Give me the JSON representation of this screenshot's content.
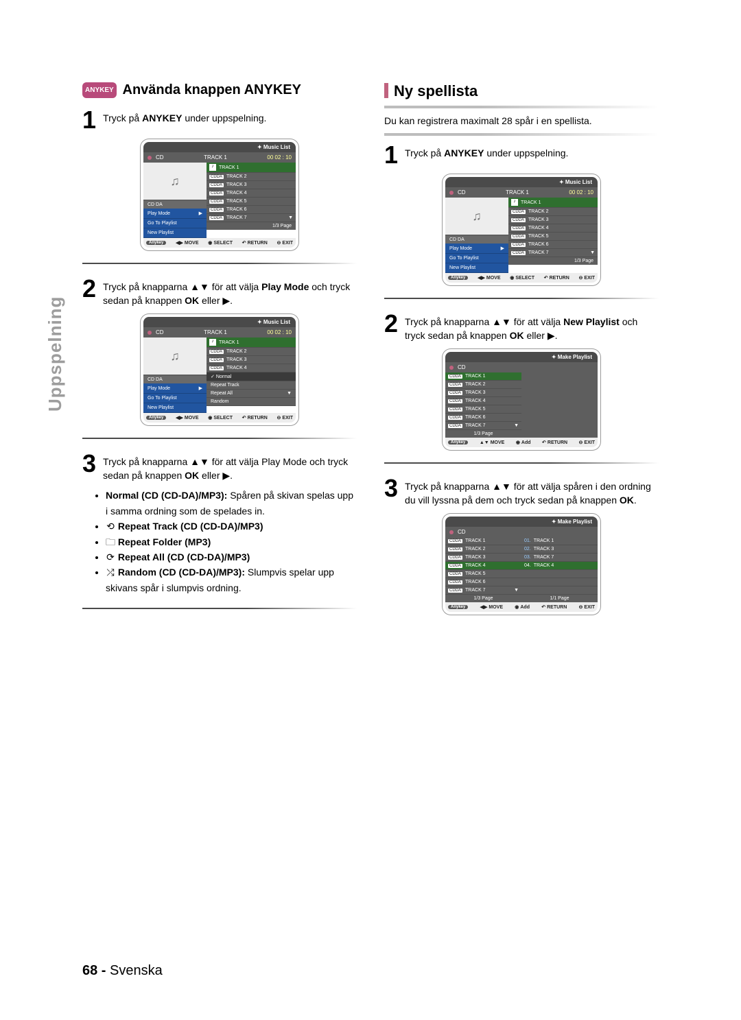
{
  "side_label": "Uppspelning",
  "footer": {
    "page": "68 -",
    "lang": "Svenska"
  },
  "left": {
    "badge": "ANYKEY",
    "heading": "Använda knappen ANYKEY",
    "step1": {
      "num": "1",
      "t1": "Tryck på ",
      "b1": "ANYKEY",
      "t2": " under uppspelning."
    },
    "step2": {
      "num": "2",
      "t1": "Tryck på knapparna ▲▼ för att välja ",
      "b1": "Play Mode",
      "t2": " och tryck sedan på knappen ",
      "b2": "OK",
      "t3": " eller ▶."
    },
    "step3": {
      "num": "3",
      "t1": "Tryck på knapparna ▲▼ för att välja Play Mode och tryck sedan på knappen ",
      "b1": "OK",
      "t2": " eller ▶."
    },
    "modes": {
      "m1a": "Normal (CD (CD-DA)/MP3):",
      "m1b": " Spåren på skivan spelas upp i samma ordning som de spelades in.",
      "m2": "Repeat Track (CD (CD-DA)/MP3)",
      "m3": "Repeat Folder (MP3)",
      "m4": "Repeat All (CD (CD-DA)/MP3)",
      "m5a": "Random (CD (CD-DA)/MP3):",
      "m5b": " Slumpvis spelar upp skivans spår i slumpvis ordning."
    }
  },
  "right": {
    "heading": "Ny spellista",
    "intro": "Du kan registrera maximalt 28 spår i en spellista.",
    "step1": {
      "num": "1",
      "t1": "Tryck på ",
      "b1": "ANYKEY",
      "t2": " under uppspelning."
    },
    "step2": {
      "num": "2",
      "t1": "Tryck på knapparna ▲▼ för att välja ",
      "b1": "New Playlist",
      "t2": " och tryck sedan på knappen ",
      "b2": "OK",
      "t3": " eller ▶."
    },
    "step3": {
      "num": "3",
      "t1": "Tryck på knapparna ▲▼ för att välja spåren i den ordning du vill lyssna på dem och tryck sedan på knappen ",
      "b1": "OK",
      "t2": "."
    }
  },
  "osd": {
    "music_title": "Music List",
    "make_title": "Make Playlist",
    "cd": "CD",
    "track_hdr": "TRACK  1",
    "time": "00 02 : 10",
    "cd_da": "CD DA",
    "cdda_tag": "CDDA",
    "tracks": [
      "TRACK 1",
      "TRACK 2",
      "TRACK 3",
      "TRACK 4",
      "TRACK 5",
      "TRACK 6",
      "TRACK 7"
    ],
    "menu": {
      "play": "Play Mode",
      "goto": "Go To Playlist",
      "newp": "New Playlist"
    },
    "submenu": [
      "Normal",
      "Repeat Track",
      "Repeat All",
      "Random"
    ],
    "pager13": "1/3 Page",
    "pager11": "1/1 Page",
    "foot": {
      "any": "Anykey",
      "move": "MOVE",
      "select": "SELECT",
      "ret": "RETURN",
      "exit": "EXIT",
      "add": "Add"
    },
    "playlist_sel": [
      {
        "n": "01.",
        "t": "TRACK 1"
      },
      {
        "n": "02.",
        "t": "TRACK 3"
      },
      {
        "n": "03.",
        "t": "TRACK 7"
      },
      {
        "n": "04.",
        "t": "TRACK 4"
      }
    ]
  }
}
